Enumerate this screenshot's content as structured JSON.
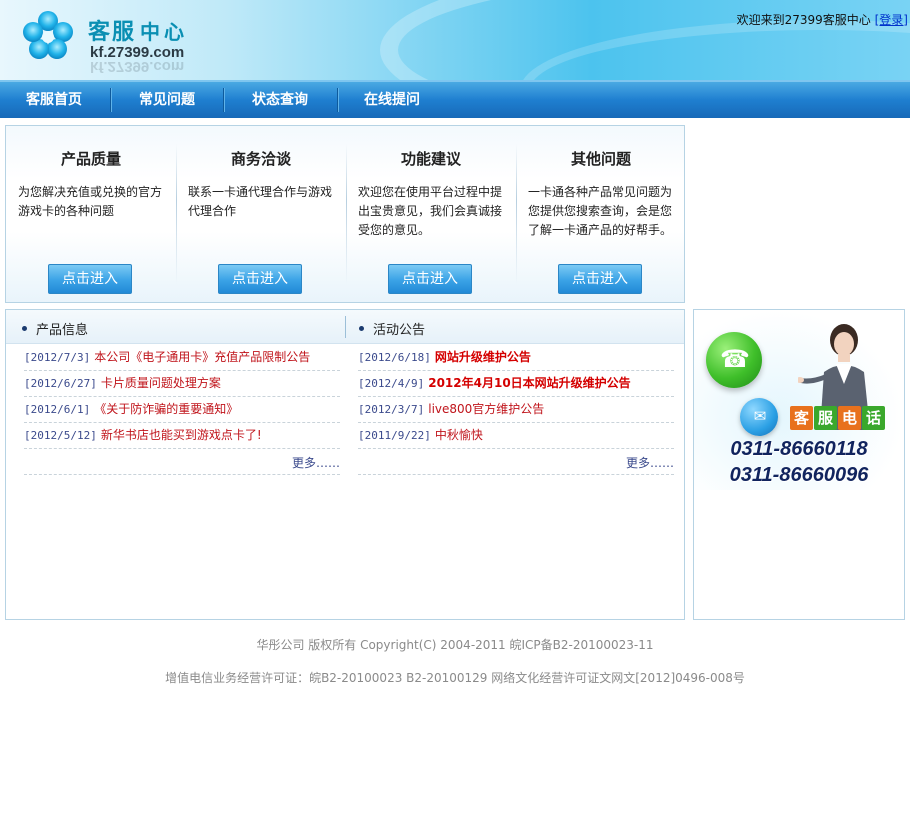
{
  "header": {
    "logo_title": "客服",
    "logo_title_2": "中心",
    "logo_url": "kf.27399.com",
    "welcome_text": "欢迎来到27399客服中心",
    "login_label": "[登录]"
  },
  "nav": {
    "items": [
      {
        "label": "客服首页"
      },
      {
        "label": "常见问题"
      },
      {
        "label": "状态查询"
      },
      {
        "label": "在线提问"
      }
    ]
  },
  "categories": [
    {
      "title": "产品质量",
      "desc": "为您解决充值或兑换的官方游戏卡的各种问题",
      "button": "点击进入"
    },
    {
      "title": "商务洽谈",
      "desc": "联系一卡通代理合作与游戏代理合作",
      "button": "点击进入"
    },
    {
      "title": "功能建议",
      "desc": "欢迎您在使用平台过程中提出宝贵意见，我们会真诚接受您的意见。",
      "button": "点击进入"
    },
    {
      "title": "其他问题",
      "desc": "一卡通各种产品常见问题为您提供您搜索查询，会是您了解一卡通产品的好帮手。",
      "button": "点击进入"
    }
  ],
  "product_info": {
    "title": "产品信息",
    "items": [
      {
        "date": "[2012/7/3]",
        "title": "本公司《电子通用卡》充值产品限制公告"
      },
      {
        "date": "[2012/6/27]",
        "title": "卡片质量问题处理方案"
      },
      {
        "date": "[2012/6/1]",
        "title": "《关于防诈骗的重要通知》"
      },
      {
        "date": "[2012/5/12]",
        "title": "新华书店也能买到游戏点卡了!"
      }
    ],
    "more": "更多……"
  },
  "announcements": {
    "title": "活动公告",
    "items": [
      {
        "date": "[2012/6/18]",
        "title": "网站升级维护公告"
      },
      {
        "date": "[2012/4/9]",
        "title": "2012年4月10日本网站升级维护公告"
      },
      {
        "date": "[2012/3/7]",
        "title": "live800官方维护公告"
      },
      {
        "date": "[2011/9/22]",
        "title": "中秋愉快"
      }
    ],
    "more": "更多……"
  },
  "service": {
    "label_chars": [
      "客",
      "服",
      "电",
      "话"
    ],
    "label_colors": [
      "#e8711d",
      "#3aa82c",
      "#e8711d",
      "#3aa82c"
    ],
    "phone_1": "0311-86660118",
    "phone_2": "0311-86660096",
    "phone_icon": "telephone-icon",
    "qq_icon": "qq-icon"
  },
  "footer": {
    "line_1": "华彤公司 版权所有 Copyright(C) 2004-2011 皖ICP备B2-20100023-11",
    "line_2": "增值电信业务经营许可证：皖B2-20100023 B2-20100129 网络文化经营许可证文网文[2012]0496-008号"
  }
}
